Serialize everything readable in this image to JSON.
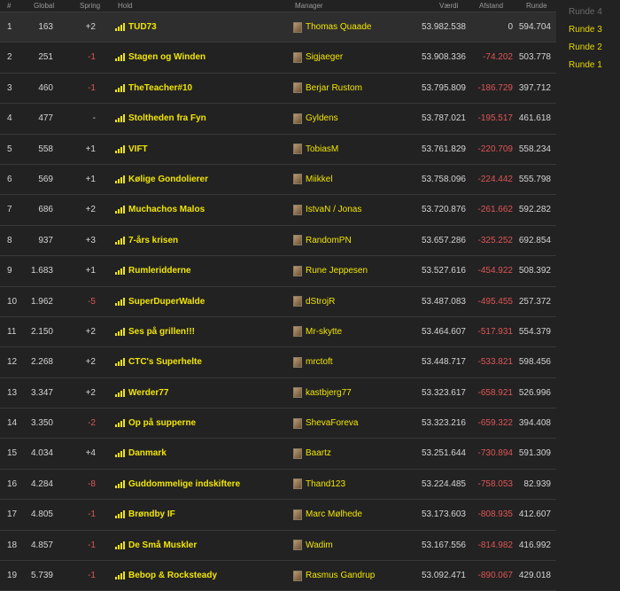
{
  "headers": {
    "rank": "#",
    "global": "Global",
    "spring": "Spring",
    "hold": "Hold",
    "manager": "Manager",
    "vaerdi": "Værdi",
    "afstand": "Afstand",
    "runde": "Runde"
  },
  "rows": [
    {
      "rank": "1",
      "global": "163",
      "spring": "+2",
      "hold": "TUD73",
      "manager": "Thomas Quaade",
      "vaerdi": "53.982.538",
      "afstand": "0",
      "runde": "594.704"
    },
    {
      "rank": "2",
      "global": "251",
      "spring": "-1",
      "hold": "Stagen og Winden",
      "manager": "Sigjaeger",
      "vaerdi": "53.908.336",
      "afstand": "-74.202",
      "runde": "503.778"
    },
    {
      "rank": "3",
      "global": "460",
      "spring": "-1",
      "hold": "TheTeacher#10",
      "manager": "Berjar Rustom",
      "vaerdi": "53.795.809",
      "afstand": "-186.729",
      "runde": "397.712"
    },
    {
      "rank": "4",
      "global": "477",
      "spring": "-",
      "hold": "Stoltheden fra Fyn",
      "manager": "Gyldens",
      "vaerdi": "53.787.021",
      "afstand": "-195.517",
      "runde": "461.618"
    },
    {
      "rank": "5",
      "global": "558",
      "spring": "+1",
      "hold": "VIFT",
      "manager": "TobiasM",
      "vaerdi": "53.761.829",
      "afstand": "-220.709",
      "runde": "558.234"
    },
    {
      "rank": "6",
      "global": "569",
      "spring": "+1",
      "hold": "Kølige Gondolierer",
      "manager": "Miikkel",
      "vaerdi": "53.758.096",
      "afstand": "-224.442",
      "runde": "555.798"
    },
    {
      "rank": "7",
      "global": "686",
      "spring": "+2",
      "hold": "Muchachos Malos",
      "manager": "IstvaN / Jonas",
      "vaerdi": "53.720.876",
      "afstand": "-261.662",
      "runde": "592.282"
    },
    {
      "rank": "8",
      "global": "937",
      "spring": "+3",
      "hold": "7-års krisen",
      "manager": "RandomPN",
      "vaerdi": "53.657.286",
      "afstand": "-325.252",
      "runde": "692.854"
    },
    {
      "rank": "9",
      "global": "1.683",
      "spring": "+1",
      "hold": "Rumleridderne",
      "manager": "Rune Jeppesen",
      "vaerdi": "53.527.616",
      "afstand": "-454.922",
      "runde": "508.392"
    },
    {
      "rank": "10",
      "global": "1.962",
      "spring": "-5",
      "hold": "SuperDuperWalde",
      "manager": "dStrojR",
      "vaerdi": "53.487.083",
      "afstand": "-495.455",
      "runde": "257.372"
    },
    {
      "rank": "11",
      "global": "2.150",
      "spring": "+2",
      "hold": "Ses på grillen!!!",
      "manager": "Mr-skytte",
      "vaerdi": "53.464.607",
      "afstand": "-517.931",
      "runde": "554.379"
    },
    {
      "rank": "12",
      "global": "2.268",
      "spring": "+2",
      "hold": "CTC's Superhelte",
      "manager": "mrctoft",
      "vaerdi": "53.448.717",
      "afstand": "-533.821",
      "runde": "598.456"
    },
    {
      "rank": "13",
      "global": "3.347",
      "spring": "+2",
      "hold": "Werder77",
      "manager": "kastbjerg77",
      "vaerdi": "53.323.617",
      "afstand": "-658.921",
      "runde": "526.996"
    },
    {
      "rank": "14",
      "global": "3.350",
      "spring": "-2",
      "hold": "Op på supperne",
      "manager": "ShevaForeva",
      "vaerdi": "53.323.216",
      "afstand": "-659.322",
      "runde": "394.408"
    },
    {
      "rank": "15",
      "global": "4.034",
      "spring": "+4",
      "hold": "Danmark",
      "manager": "Baartz",
      "vaerdi": "53.251.644",
      "afstand": "-730.894",
      "runde": "591.309"
    },
    {
      "rank": "16",
      "global": "4.284",
      "spring": "-8",
      "hold": "Guddommelige indskiftere",
      "manager": "Thand123",
      "vaerdi": "53.224.485",
      "afstand": "-758.053",
      "runde": "82.939"
    },
    {
      "rank": "17",
      "global": "4.805",
      "spring": "-1",
      "hold": "Brøndby IF",
      "manager": "Marc Mølhede",
      "vaerdi": "53.173.603",
      "afstand": "-808.935",
      "runde": "412.607"
    },
    {
      "rank": "18",
      "global": "4.857",
      "spring": "-1",
      "hold": "De Små Muskler",
      "manager": "Wadim",
      "vaerdi": "53.167.556",
      "afstand": "-814.982",
      "runde": "416.992"
    },
    {
      "rank": "19",
      "global": "5.739",
      "spring": "-1",
      "hold": "Bebop & Rocksteady",
      "manager": "Rasmus Gandrup",
      "vaerdi": "53.092.471",
      "afstand": "-890.067",
      "runde": "429.018"
    }
  ],
  "rounds": [
    {
      "label": "Runde 4",
      "active": false
    },
    {
      "label": "Runde 3",
      "active": true
    },
    {
      "label": "Runde 2",
      "active": true
    },
    {
      "label": "Runde 1",
      "active": true
    }
  ],
  "colors": {
    "background": "#222222",
    "team_name": "#f2e600",
    "negative": "#e05555",
    "text": "#d4d4d4"
  },
  "icons": {
    "team": "bar-chart-icon",
    "manager": "avatar"
  }
}
